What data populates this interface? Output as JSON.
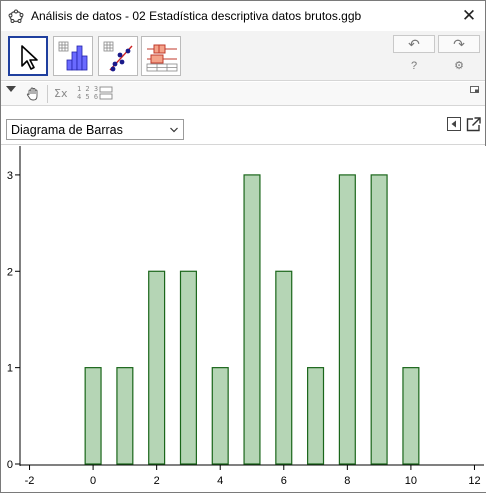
{
  "window": {
    "title": "Análisis de datos - 02 Estadística descriptiva datos brutos.ggb",
    "close_label": "✕"
  },
  "toolbar": {
    "tools": [
      {
        "name": "move-graphics-view-tool",
        "icon": "pointer-arrow-icon",
        "selected": true
      },
      {
        "name": "one-variable-analysis-tool",
        "icon": "histogram-icon",
        "selected": false
      },
      {
        "name": "two-variable-regression-tool",
        "icon": "scatter-regression-icon",
        "selected": false
      },
      {
        "name": "multiple-variable-analysis-tool",
        "icon": "boxplot-icon",
        "selected": false
      }
    ],
    "undo_label": "↶",
    "redo_label": "↷",
    "help_label": "?",
    "settings_label": "⚙"
  },
  "stylebar": {
    "sigma_label": "Σx",
    "numbers_label_top": "1 2 3",
    "numbers_label_bottom": "4 5 6"
  },
  "chart_selector": {
    "selected": "Diagrama de Barras"
  },
  "chart_data": {
    "type": "bar",
    "categories": [
      0,
      1,
      2,
      3,
      4,
      5,
      6,
      7,
      8,
      9,
      10
    ],
    "values": [
      1,
      1,
      2,
      2,
      1,
      3,
      2,
      1,
      3,
      3,
      1
    ],
    "xlim": [
      -2.3,
      12.3
    ],
    "ylim": [
      0,
      3.3
    ],
    "x_ticks": [
      -2,
      0,
      2,
      4,
      6,
      8,
      10,
      12
    ],
    "y_ticks": [
      0,
      1,
      2,
      3
    ],
    "bar_width": 0.5,
    "bar_fill": "#b5d5b5",
    "bar_stroke": "#1a661a",
    "grid": false
  },
  "colors": {
    "accent_selected": "#1f3f9e"
  }
}
